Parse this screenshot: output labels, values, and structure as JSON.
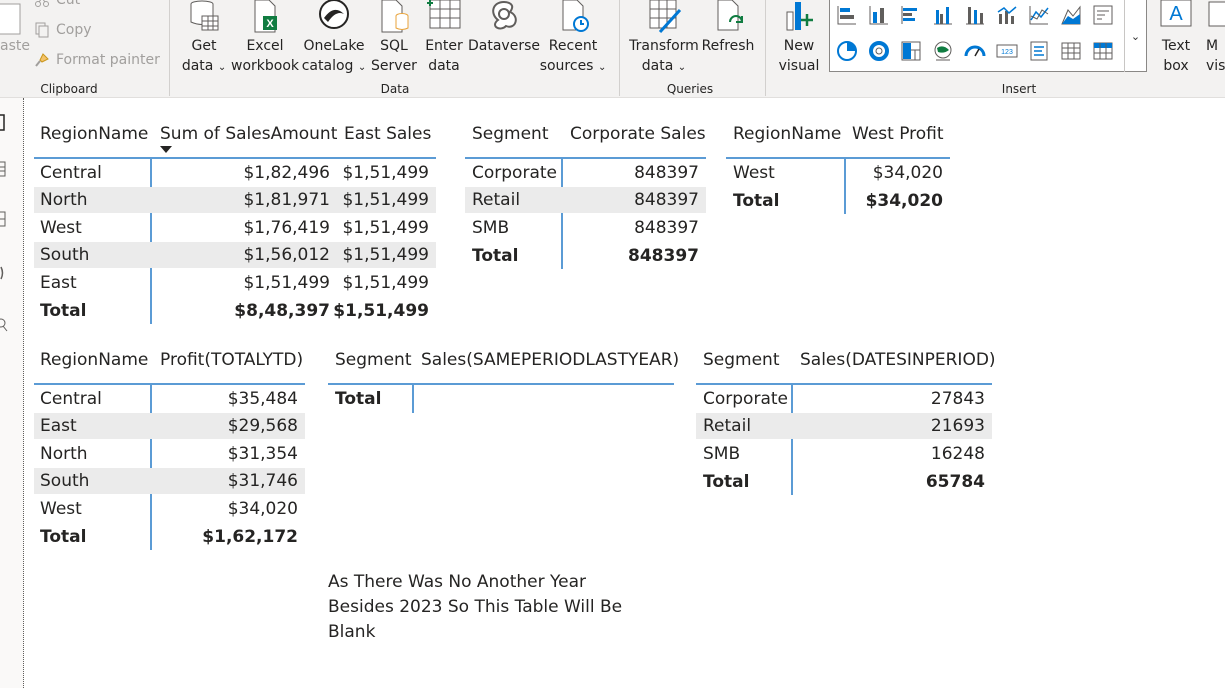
{
  "ribbon": {
    "clipboard": {
      "paste": "aste",
      "cut": "Cut",
      "copy": "Copy",
      "format_painter": "Format painter",
      "group": "Clipboard"
    },
    "data_group": {
      "group": "Data",
      "get_data": [
        "Get",
        "data"
      ],
      "excel": [
        "Excel",
        "workbook"
      ],
      "onelake": [
        "OneLake",
        "catalog"
      ],
      "sql": [
        "SQL",
        "Server"
      ],
      "enter": [
        "Enter",
        "data"
      ],
      "dataverse": [
        "Dataverse"
      ],
      "recent": [
        "Recent",
        "sources"
      ]
    },
    "queries_group": {
      "group": "Queries",
      "transform": [
        "Transform",
        "data"
      ],
      "refresh": [
        "Refresh"
      ]
    },
    "insert_group": {
      "group": "Insert",
      "new_visual": [
        "New",
        "visual"
      ],
      "text_box": [
        "Text",
        "box"
      ],
      "more": [
        "M",
        "visu"
      ]
    }
  },
  "tables": {
    "region_sales": {
      "headers": [
        "RegionName",
        "Sum of SalesAmount",
        "East Sales"
      ],
      "rows": [
        [
          "Central",
          "$1,82,496",
          "$1,51,499"
        ],
        [
          "North",
          "$1,81,971",
          "$1,51,499"
        ],
        [
          "West",
          "$1,76,419",
          "$1,51,499"
        ],
        [
          "South",
          "$1,56,012",
          "$1,51,499"
        ],
        [
          "East",
          "$1,51,499",
          "$1,51,499"
        ]
      ],
      "total": [
        "Total",
        "$8,48,397",
        "$1,51,499"
      ]
    },
    "segment_corporate": {
      "headers": [
        "Segment",
        "Corporate Sales"
      ],
      "rows": [
        [
          "Corporate",
          "848397"
        ],
        [
          "Retail",
          "848397"
        ],
        [
          "SMB",
          "848397"
        ]
      ],
      "total": [
        "Total",
        "848397"
      ]
    },
    "west_profit": {
      "headers": [
        "RegionName",
        "West Profit"
      ],
      "rows": [
        [
          "West",
          "$34,020"
        ]
      ],
      "total": [
        "Total",
        "$34,020"
      ]
    },
    "profit_ytd": {
      "headers": [
        "RegionName",
        "Profit(TOTALYTD)"
      ],
      "rows": [
        [
          "Central",
          "$35,484"
        ],
        [
          "East",
          "$29,568"
        ],
        [
          "North",
          "$31,354"
        ],
        [
          "South",
          "$31,746"
        ],
        [
          "West",
          "$34,020"
        ]
      ],
      "total": [
        "Total",
        "$1,62,172"
      ]
    },
    "sales_sply": {
      "headers": [
        "Segment",
        "Sales(SAMEPERIODLASTYEAR)"
      ],
      "total": [
        "Total",
        ""
      ]
    },
    "sales_dip": {
      "headers": [
        "Segment",
        "Sales(DATESINPERIOD)"
      ],
      "rows": [
        [
          "Corporate",
          "27843"
        ],
        [
          "Retail",
          "21693"
        ],
        [
          "SMB",
          "16248"
        ]
      ],
      "total": [
        "Total",
        "65784"
      ]
    }
  },
  "note": "As There Was No Another Year Besides 2023 So This Table Will Be Blank",
  "colors": {
    "accent_line": "#5b9bd5",
    "stripe": "#ebebeb",
    "ribbon_bg": "#f3f2f1"
  }
}
